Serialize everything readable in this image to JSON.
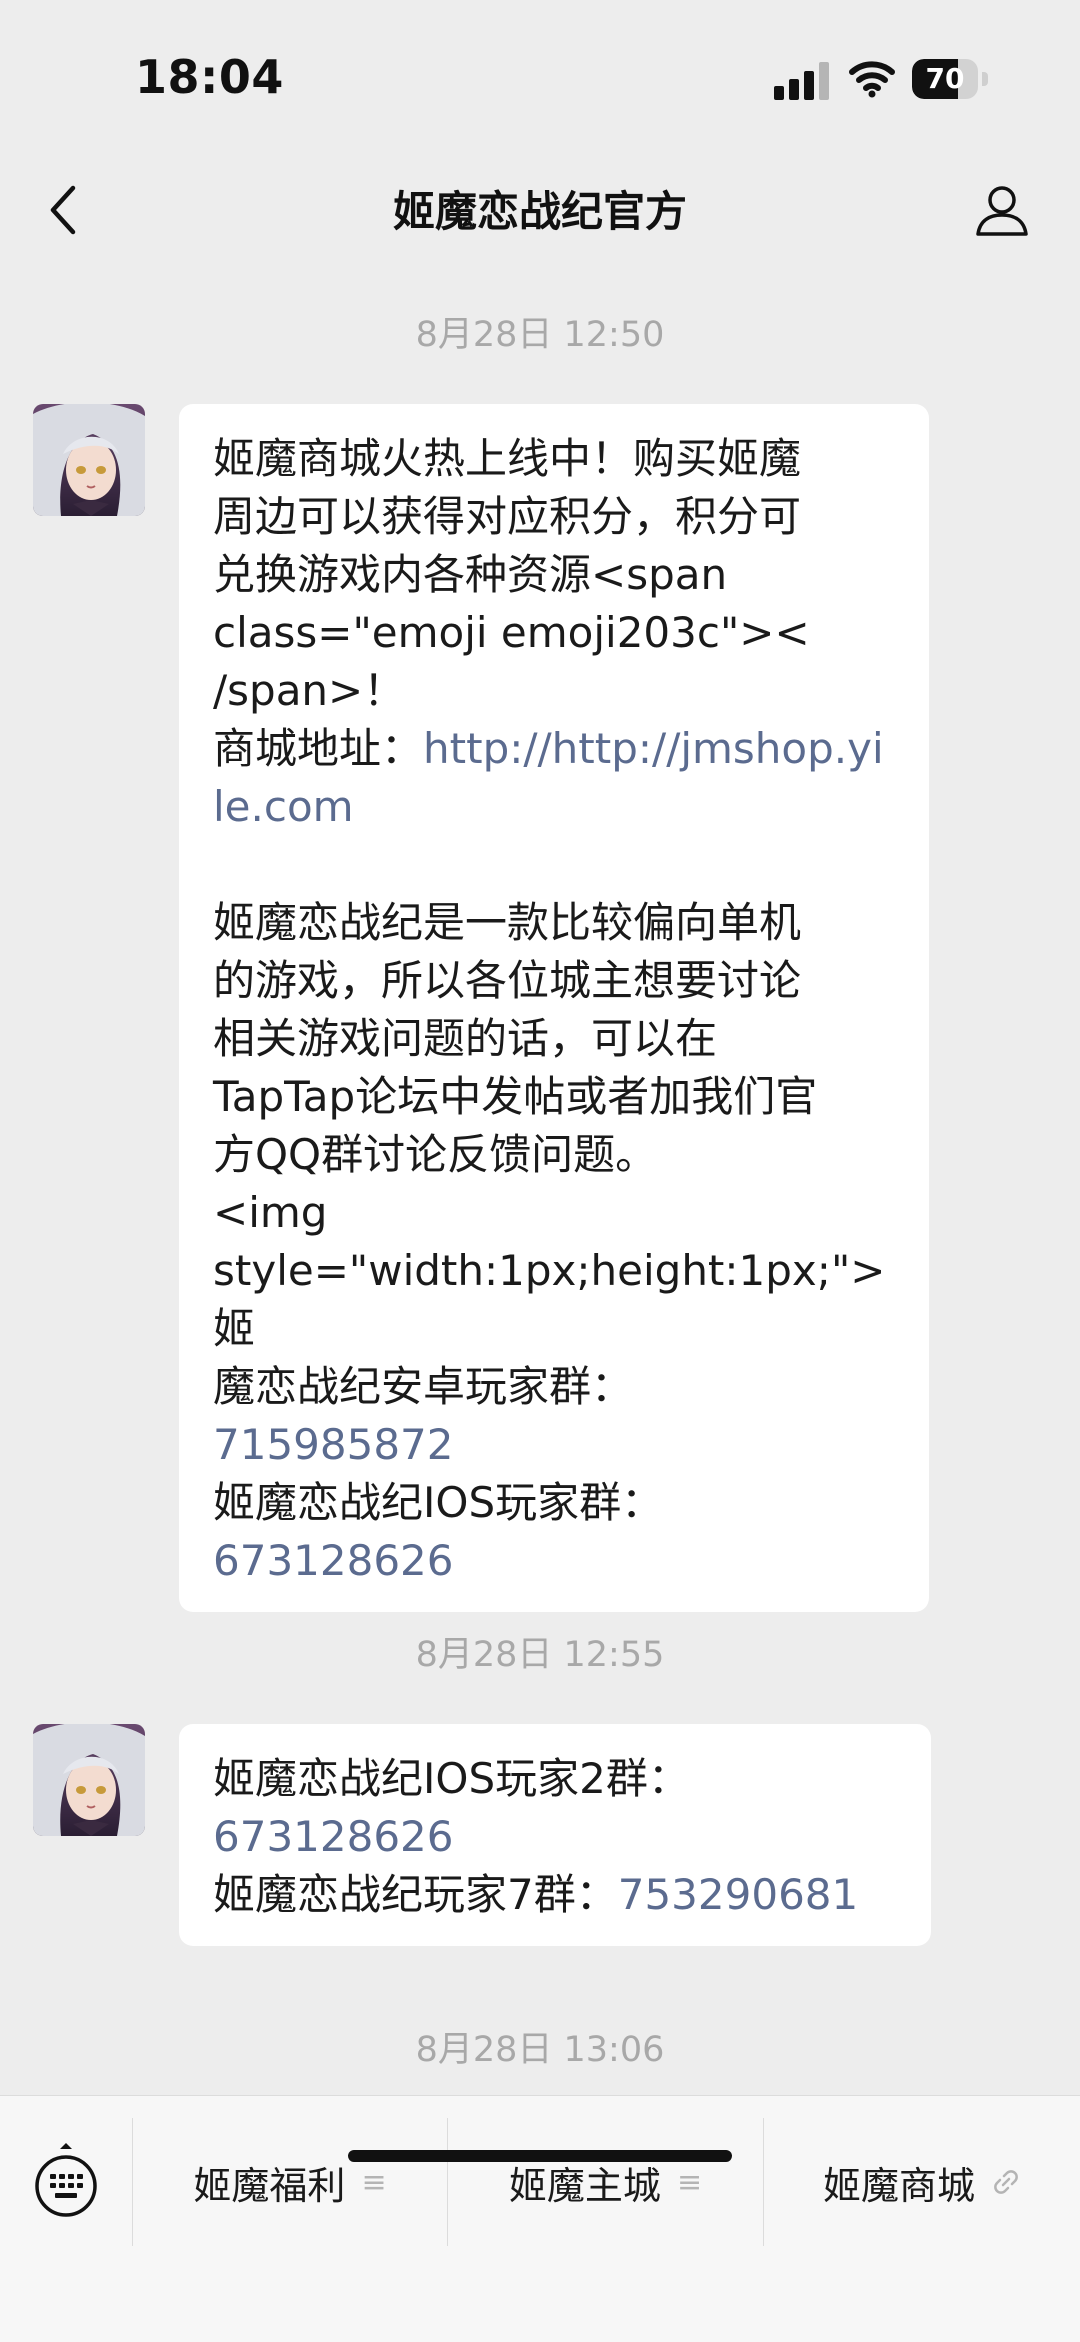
{
  "status_bar": {
    "time": "18:04",
    "battery_percent": 70,
    "battery_label": "70",
    "icons": [
      "cellular-signal-icon",
      "wifi-icon",
      "battery-icon"
    ]
  },
  "nav": {
    "title": "姬魔恋战纪官方",
    "back_icon": "chevron-left-icon",
    "profile_icon": "person-icon"
  },
  "chat": {
    "timestamps": [
      "8月28日 12:50",
      "8月28日 12:55",
      "8月28日 13:06"
    ],
    "message1": {
      "lines": [
        "姬魔商城火热上线中！购买姬魔",
        "周边可以获得对应积分，积分可",
        "兑换游戏内各种资源<span",
        "class=\"emoji emoji203c\"><",
        "/span>！"
      ],
      "shop_label": "商城地址：",
      "shop_url": "http://http://jmshop.yile.com",
      "para2_lines": [
        "姬魔恋战纪是一款比较偏向单机",
        "的游戏，所以各位城主想要讨论",
        "相关游戏问题的话，可以在",
        "TapTap论坛中发帖或者加我们官",
        "方QQ群讨论反馈问题。",
        "<img",
        "style=\"width:1px;height:1px;\">姬",
        "魔恋战纪安卓玩家群："
      ],
      "android_group": "715985872",
      "ios_label": "姬魔恋战纪IOS玩家群：",
      "ios_group": "673128626"
    },
    "message2": {
      "ios2_label": "姬魔恋战纪IOS玩家2群：",
      "ios2_group": "673128626",
      "group7_label": "姬魔恋战纪玩家7群：",
      "group7_number": "753290681"
    }
  },
  "bottom_menu": {
    "keyboard_icon": "keyboard-icon",
    "items": [
      {
        "label": "姬魔福利",
        "glyph": "≡",
        "icon": "submenu-icon"
      },
      {
        "label": "姬魔主城",
        "glyph": "≡",
        "icon": "submenu-icon"
      },
      {
        "label": "姬魔商城",
        "glyph": "🔗",
        "icon": "link-icon"
      }
    ]
  },
  "colors": {
    "background": "#ededed",
    "bubble": "#ffffff",
    "link": "#5b6b8f",
    "timestamp": "#a8a8a8"
  }
}
